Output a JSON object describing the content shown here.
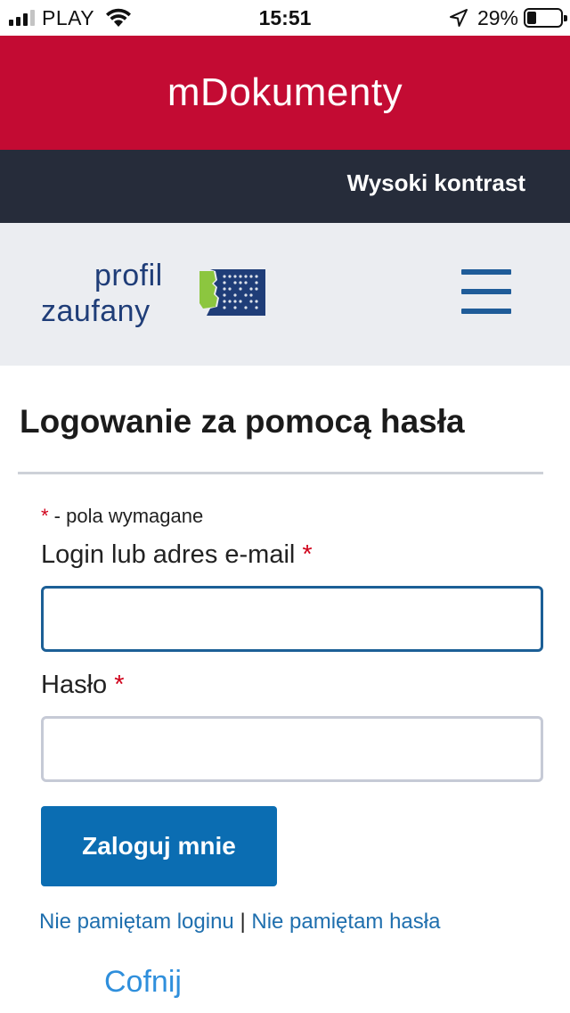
{
  "status_bar": {
    "carrier": "PLAY",
    "time": "15:51",
    "battery_percent": "29%",
    "battery_level": 0.29,
    "signal_bars_on": 3,
    "signal_bars_total": 4,
    "icons": [
      "signal-icon",
      "wifi-icon",
      "location-arrow-icon",
      "battery-icon"
    ]
  },
  "header": {
    "title": "mDokumenty",
    "background_color": "#c30b33"
  },
  "contrast_bar": {
    "link_label": "Wysoki kontrast",
    "background_color": "#262c3a"
  },
  "logo": {
    "line1": "profil",
    "line2": "zaufany",
    "icon": "profil-zaufany-logo-mark"
  },
  "menu": {
    "icon": "hamburger-menu-icon"
  },
  "form": {
    "title": "Logowanie za pomocą hasła",
    "required_marker": "*",
    "required_note": " - pola wymagane",
    "login_label": "Login lub adres e-mail",
    "login_value": "",
    "password_label": "Hasło",
    "password_value": "",
    "submit_label": "Zaloguj mnie",
    "accent_color": "#0b6db2"
  },
  "links": {
    "forgot_login": "Nie pamiętam loginu",
    "separator": " | ",
    "forgot_password": "Nie pamiętam hasła",
    "back": "Cofnij"
  }
}
